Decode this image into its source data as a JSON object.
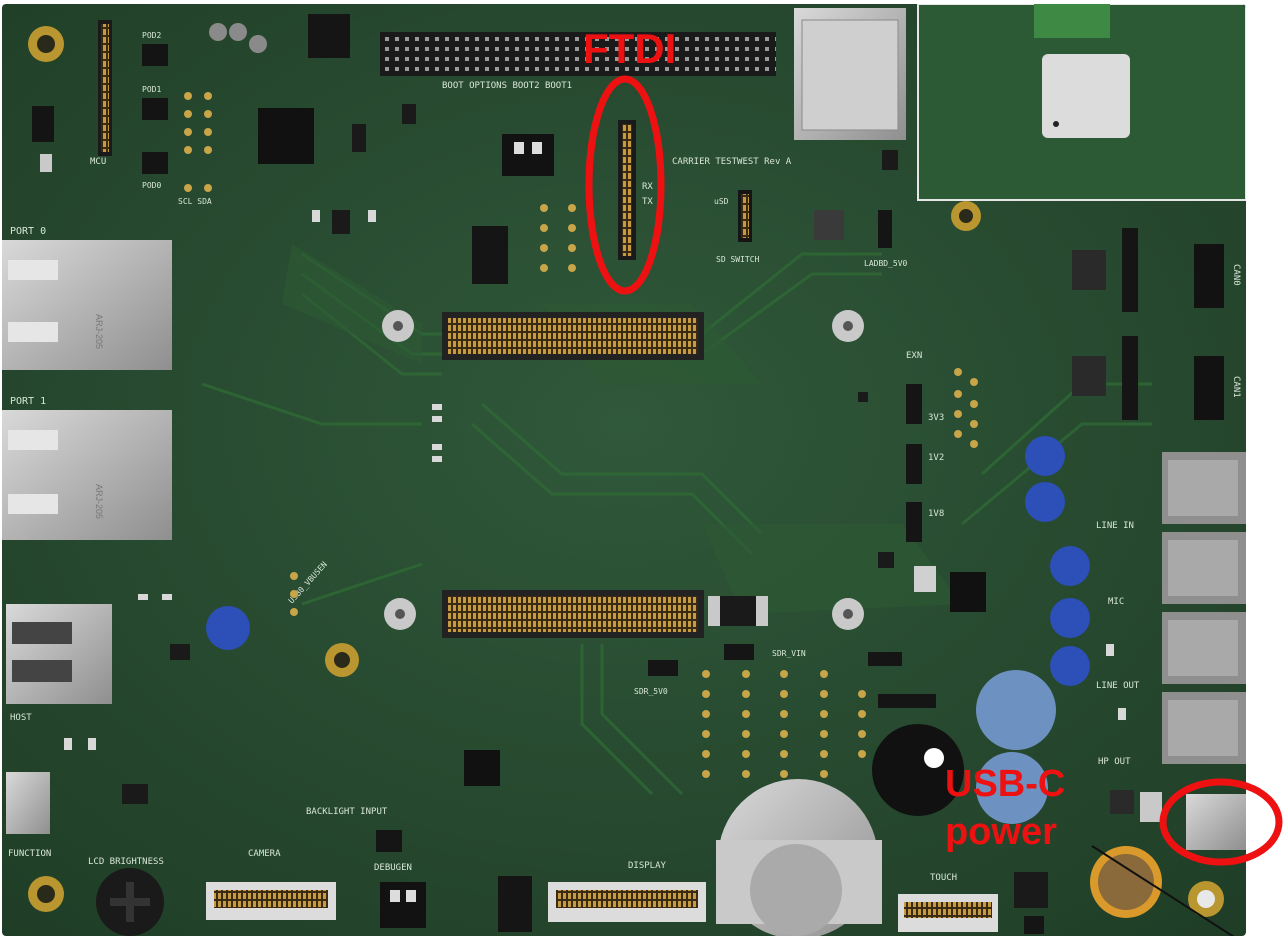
{
  "callouts": {
    "ftdi": "FTDI",
    "usbc_line1": "USB-C",
    "usbc_line2": "power"
  },
  "silkscreen": {
    "port0": "PORT 0",
    "port1": "PORT 1",
    "rj45_a": "ARJ-205",
    "rj45_b": "ARJ-205",
    "host": "HOST",
    "function": "FUNCTION",
    "lcd_brightness": "LCD BRIGHTNESS",
    "camera": "CAMERA",
    "backlight_input": "BACKLIGHT INPUT",
    "debugen": "DEBUGEN",
    "display": "DISPLAY",
    "touch": "TOUCH",
    "line_in": "LINE IN",
    "line_out": "LINE OUT",
    "mic": "MIC",
    "hp_out": "HP OUT",
    "can0": "CAN0",
    "can1": "CAN1",
    "exn": "EXN",
    "ladbd_5v0": "LADBD_5V0",
    "sd_switch": "SD SWITCH",
    "usd": "uSD",
    "rx": "RX",
    "tx": "TX",
    "sdr_5v0": "SDR_5V0",
    "sdr_vin": "SDR_VIN",
    "carrier": "CARRIER TESTWEST Rev A",
    "boot_options": "BOOT OPTIONS BOOT2 BOOT1",
    "scl_sda": "SCL SDA",
    "mcu": "MCU",
    "v3v3": "3V3",
    "v1v2": "1V2",
    "v1v8": "1V8",
    "pod2": "POD2",
    "pod1": "POD1",
    "pod0": "POD0"
  },
  "colors": {
    "pcb_green": "#2a4a2e",
    "trace_green": "#2f6a35",
    "callout_red": "#ee1111",
    "gold_pad": "#b9962f",
    "silver_metal": "#b9b9b9",
    "blue_cap": "#2c4fb8",
    "steel_blue_cap": "#6d92c2"
  }
}
